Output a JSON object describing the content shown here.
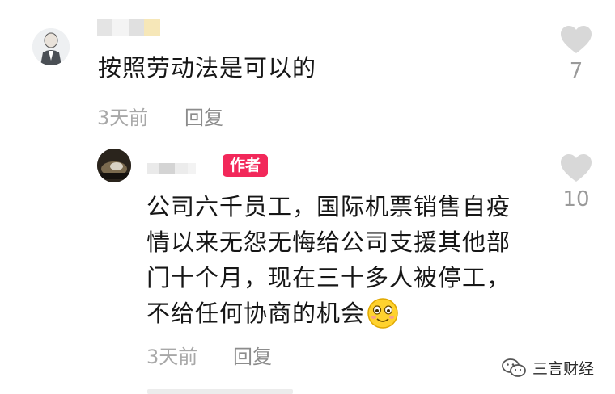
{
  "comments": [
    {
      "text": "按照劳动法是可以的",
      "time": "3天前",
      "reply_label": "回复",
      "likes": "7"
    },
    {
      "badge": "作者",
      "lines": [
        "公司六千员工，国际机票销售自疫",
        "情以来无怨无悔给公司支援其他部",
        "门十个月，现在三十多人被停工，",
        "不给任何协商的机会"
      ],
      "time": "3天前",
      "reply_label": "回复",
      "likes": "10"
    }
  ],
  "watermark": {
    "text": "三言财经",
    "icon": "wechat-icon"
  },
  "colors": {
    "badge": "#f2285a",
    "meta": "#a8a8a8",
    "heart": "#d8d8d8"
  }
}
